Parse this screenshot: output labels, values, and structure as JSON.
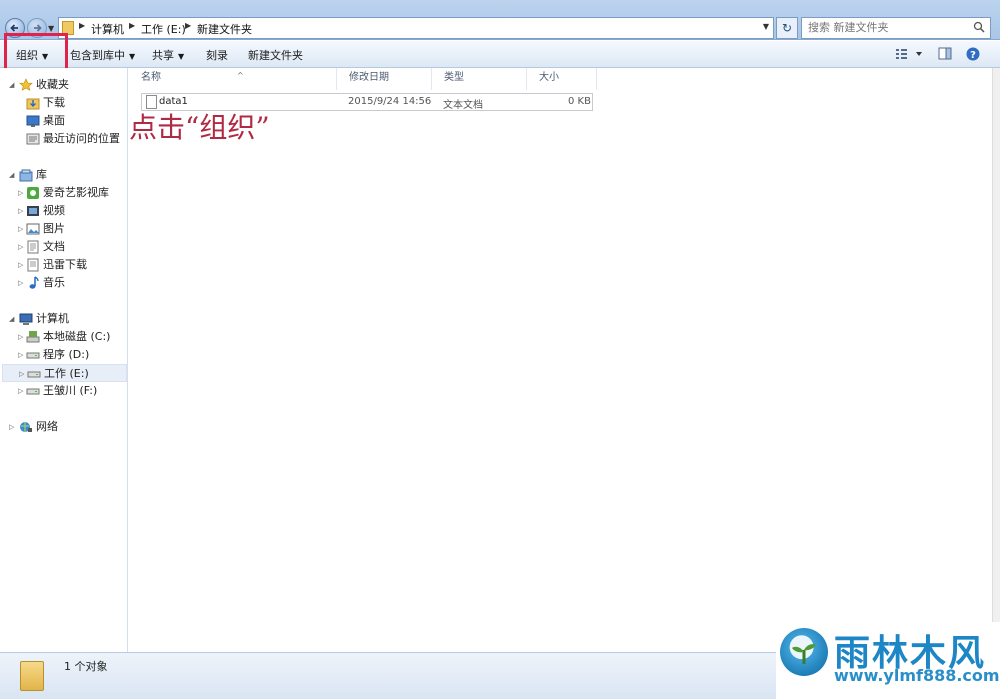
{
  "address": {
    "crumbs": [
      "计算机",
      "工作 (E:)",
      "新建文件夹"
    ]
  },
  "search": {
    "placeholder": "搜索 新建文件夹"
  },
  "toolbar": {
    "organize": "组织",
    "include_in_library": "包含到库中",
    "share": "共享",
    "burn": "刻录",
    "new_folder": "新建文件夹"
  },
  "nav": {
    "favorites": "收藏夹",
    "downloads": "下载",
    "desktop": "桌面",
    "recent": "最近访问的位置",
    "libraries": "库",
    "iqiyi": "爱奇艺影视库",
    "videos": "视频",
    "pictures": "图片",
    "documents": "文档",
    "xunlei": "迅雷下载",
    "music": "音乐",
    "computer": "计算机",
    "drive_c": "本地磁盘 (C:)",
    "drive_d": "程序 (D:)",
    "drive_e": "工作 (E:)",
    "drive_f": "王皱川 (F:)",
    "network": "网络"
  },
  "columns": [
    "名称",
    "修改日期",
    "类型",
    "大小"
  ],
  "files": [
    {
      "name": "data1",
      "date": "2015/9/24 14:56",
      "type": "文本文档",
      "size": "0 KB"
    }
  ],
  "annotation": "点击“组织”",
  "status": {
    "count": "1 个对象"
  },
  "watermark": {
    "title": "雨林木风",
    "url": "www.ylmf888.com"
  },
  "colors": {
    "highlight": "#e0234a",
    "annotation": "#b02a44",
    "watermark": "#1c86c6"
  }
}
